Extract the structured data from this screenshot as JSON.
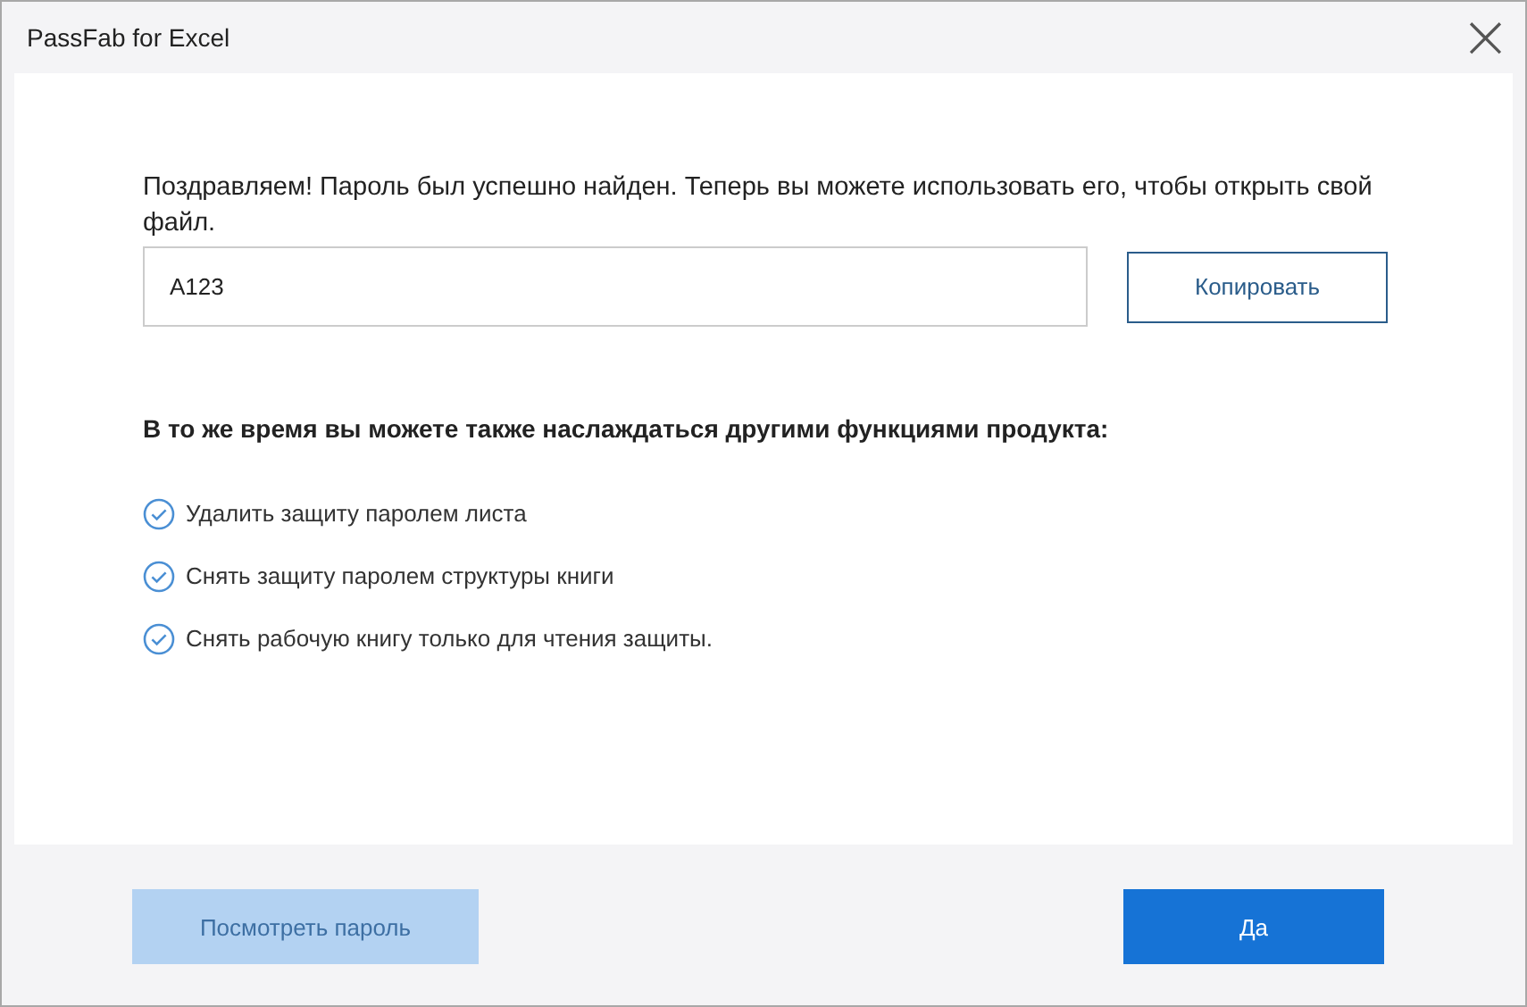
{
  "window": {
    "title": "PassFab for Excel",
    "close": "×"
  },
  "message": "Поздравляем! Пароль был успешно найден. Теперь вы можете использовать его, чтобы открыть свой файл.",
  "password_field": {
    "value": "A123"
  },
  "copy_button": "Копировать",
  "features_heading": "В то же время вы можете также наслаждаться другими функциями продукта:",
  "features": [
    "Удалить защиту паролем листа",
    "Снять защиту паролем структуры книги",
    "Снять рабочую книгу только для чтения защиты."
  ],
  "buttons": [
    {
      "label": "Посмотреть пароль",
      "kind": "secondary",
      "disabled": true
    },
    {
      "label": "Да",
      "kind": "primary",
      "disabled": false
    }
  ]
}
